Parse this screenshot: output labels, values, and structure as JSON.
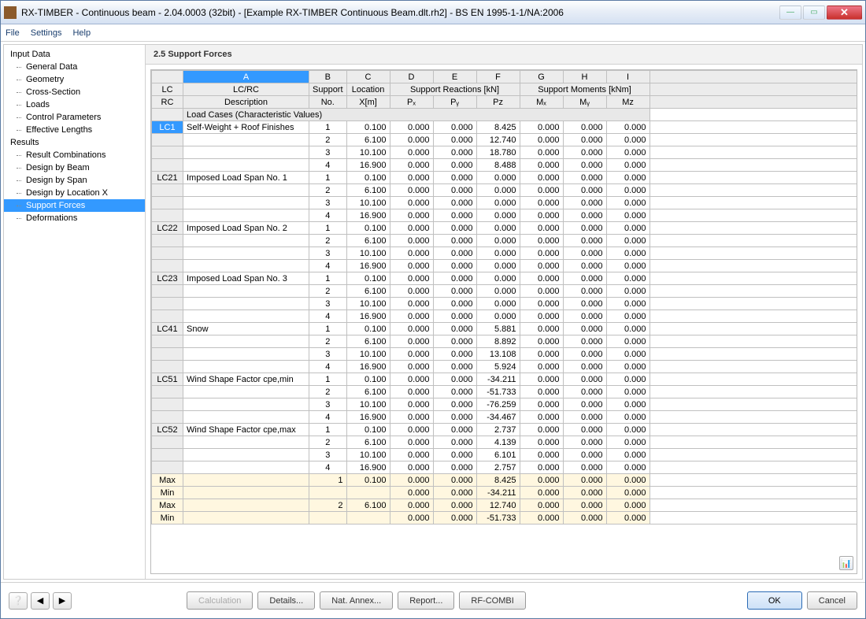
{
  "window": {
    "title": "RX-TIMBER - Continuous beam - 2.04.0003 (32bit) - [Example RX-TIMBER Continuous Beam.dlt.rh2] - BS EN 1995-1-1/NA:2006"
  },
  "menu": [
    "File",
    "Settings",
    "Help"
  ],
  "sidebar": {
    "groups": [
      {
        "label": "Input Data",
        "items": [
          "General Data",
          "Geometry",
          "Cross-Section",
          "Loads",
          "Control Parameters",
          "Effective Lengths"
        ]
      },
      {
        "label": "Results",
        "items": [
          "Result Combinations",
          "Design by Beam",
          "Design by Span",
          "Design by Location X",
          "Support Forces",
          "Deformations"
        ]
      }
    ],
    "selected": "Support Forces"
  },
  "section": {
    "title": "2.5 Support Forces"
  },
  "table": {
    "letters": [
      "A",
      "B",
      "C",
      "D",
      "E",
      "F",
      "G",
      "H",
      "I"
    ],
    "header1": {
      "lc": "LC",
      "desc": "LC/RC",
      "support": "Support",
      "location": "Location",
      "reactions": "Support Reactions [kN]",
      "moments": "Support Moments [kNm]"
    },
    "header2": {
      "rc": "RC",
      "desc": "Description",
      "no": "No.",
      "x": "X[m]",
      "px": "Pₓ",
      "py": "Pᵧ",
      "pz": "Pz",
      "mx": "Mₓ",
      "my": "Mᵧ",
      "mz": "Mz"
    },
    "group_label": "Load Cases (Characteristic Values)",
    "cases": [
      {
        "id": "LC1",
        "desc": "Self-Weight + Roof Finishes",
        "rows": [
          {
            "no": "1",
            "x": "0.100",
            "px": "0.000",
            "py": "0.000",
            "pz": "8.425",
            "mx": "0.000",
            "my": "0.000",
            "mz": "0.000"
          },
          {
            "no": "2",
            "x": "6.100",
            "px": "0.000",
            "py": "0.000",
            "pz": "12.740",
            "mx": "0.000",
            "my": "0.000",
            "mz": "0.000"
          },
          {
            "no": "3",
            "x": "10.100",
            "px": "0.000",
            "py": "0.000",
            "pz": "18.780",
            "mx": "0.000",
            "my": "0.000",
            "mz": "0.000"
          },
          {
            "no": "4",
            "x": "16.900",
            "px": "0.000",
            "py": "0.000",
            "pz": "8.488",
            "mx": "0.000",
            "my": "0.000",
            "mz": "0.000"
          }
        ]
      },
      {
        "id": "LC21",
        "desc": "Imposed Load Span No. 1",
        "rows": [
          {
            "no": "1",
            "x": "0.100",
            "px": "0.000",
            "py": "0.000",
            "pz": "0.000",
            "mx": "0.000",
            "my": "0.000",
            "mz": "0.000"
          },
          {
            "no": "2",
            "x": "6.100",
            "px": "0.000",
            "py": "0.000",
            "pz": "0.000",
            "mx": "0.000",
            "my": "0.000",
            "mz": "0.000"
          },
          {
            "no": "3",
            "x": "10.100",
            "px": "0.000",
            "py": "0.000",
            "pz": "0.000",
            "mx": "0.000",
            "my": "0.000",
            "mz": "0.000"
          },
          {
            "no": "4",
            "x": "16.900",
            "px": "0.000",
            "py": "0.000",
            "pz": "0.000",
            "mx": "0.000",
            "my": "0.000",
            "mz": "0.000"
          }
        ]
      },
      {
        "id": "LC22",
        "desc": "Imposed Load Span No. 2",
        "rows": [
          {
            "no": "1",
            "x": "0.100",
            "px": "0.000",
            "py": "0.000",
            "pz": "0.000",
            "mx": "0.000",
            "my": "0.000",
            "mz": "0.000"
          },
          {
            "no": "2",
            "x": "6.100",
            "px": "0.000",
            "py": "0.000",
            "pz": "0.000",
            "mx": "0.000",
            "my": "0.000",
            "mz": "0.000"
          },
          {
            "no": "3",
            "x": "10.100",
            "px": "0.000",
            "py": "0.000",
            "pz": "0.000",
            "mx": "0.000",
            "my": "0.000",
            "mz": "0.000"
          },
          {
            "no": "4",
            "x": "16.900",
            "px": "0.000",
            "py": "0.000",
            "pz": "0.000",
            "mx": "0.000",
            "my": "0.000",
            "mz": "0.000"
          }
        ]
      },
      {
        "id": "LC23",
        "desc": "Imposed Load Span No. 3",
        "rows": [
          {
            "no": "1",
            "x": "0.100",
            "px": "0.000",
            "py": "0.000",
            "pz": "0.000",
            "mx": "0.000",
            "my": "0.000",
            "mz": "0.000"
          },
          {
            "no": "2",
            "x": "6.100",
            "px": "0.000",
            "py": "0.000",
            "pz": "0.000",
            "mx": "0.000",
            "my": "0.000",
            "mz": "0.000"
          },
          {
            "no": "3",
            "x": "10.100",
            "px": "0.000",
            "py": "0.000",
            "pz": "0.000",
            "mx": "0.000",
            "my": "0.000",
            "mz": "0.000"
          },
          {
            "no": "4",
            "x": "16.900",
            "px": "0.000",
            "py": "0.000",
            "pz": "0.000",
            "mx": "0.000",
            "my": "0.000",
            "mz": "0.000"
          }
        ]
      },
      {
        "id": "LC41",
        "desc": "Snow",
        "rows": [
          {
            "no": "1",
            "x": "0.100",
            "px": "0.000",
            "py": "0.000",
            "pz": "5.881",
            "mx": "0.000",
            "my": "0.000",
            "mz": "0.000"
          },
          {
            "no": "2",
            "x": "6.100",
            "px": "0.000",
            "py": "0.000",
            "pz": "8.892",
            "mx": "0.000",
            "my": "0.000",
            "mz": "0.000"
          },
          {
            "no": "3",
            "x": "10.100",
            "px": "0.000",
            "py": "0.000",
            "pz": "13.108",
            "mx": "0.000",
            "my": "0.000",
            "mz": "0.000"
          },
          {
            "no": "4",
            "x": "16.900",
            "px": "0.000",
            "py": "0.000",
            "pz": "5.924",
            "mx": "0.000",
            "my": "0.000",
            "mz": "0.000"
          }
        ]
      },
      {
        "id": "LC51",
        "desc": "Wind Shape Factor cpe,min",
        "rows": [
          {
            "no": "1",
            "x": "0.100",
            "px": "0.000",
            "py": "0.000",
            "pz": "-34.211",
            "mx": "0.000",
            "my": "0.000",
            "mz": "0.000"
          },
          {
            "no": "2",
            "x": "6.100",
            "px": "0.000",
            "py": "0.000",
            "pz": "-51.733",
            "mx": "0.000",
            "my": "0.000",
            "mz": "0.000"
          },
          {
            "no": "3",
            "x": "10.100",
            "px": "0.000",
            "py": "0.000",
            "pz": "-76.259",
            "mx": "0.000",
            "my": "0.000",
            "mz": "0.000"
          },
          {
            "no": "4",
            "x": "16.900",
            "px": "0.000",
            "py": "0.000",
            "pz": "-34.467",
            "mx": "0.000",
            "my": "0.000",
            "mz": "0.000"
          }
        ]
      },
      {
        "id": "LC52",
        "desc": "Wind Shape Factor cpe,max",
        "rows": [
          {
            "no": "1",
            "x": "0.100",
            "px": "0.000",
            "py": "0.000",
            "pz": "2.737",
            "mx": "0.000",
            "my": "0.000",
            "mz": "0.000"
          },
          {
            "no": "2",
            "x": "6.100",
            "px": "0.000",
            "py": "0.000",
            "pz": "4.139",
            "mx": "0.000",
            "my": "0.000",
            "mz": "0.000"
          },
          {
            "no": "3",
            "x": "10.100",
            "px": "0.000",
            "py": "0.000",
            "pz": "6.101",
            "mx": "0.000",
            "my": "0.000",
            "mz": "0.000"
          },
          {
            "no": "4",
            "x": "16.900",
            "px": "0.000",
            "py": "0.000",
            "pz": "2.757",
            "mx": "0.000",
            "my": "0.000",
            "mz": "0.000"
          }
        ]
      }
    ],
    "summary": [
      {
        "label": "Max",
        "no": "1",
        "x": "0.100",
        "px": "0.000",
        "py": "0.000",
        "pz": "8.425",
        "mx": "0.000",
        "my": "0.000",
        "mz": "0.000"
      },
      {
        "label": "Min",
        "no": "",
        "x": "",
        "px": "0.000",
        "py": "0.000",
        "pz": "-34.211",
        "mx": "0.000",
        "my": "0.000",
        "mz": "0.000"
      },
      {
        "label": "Max",
        "no": "2",
        "x": "6.100",
        "px": "0.000",
        "py": "0.000",
        "pz": "12.740",
        "mx": "0.000",
        "my": "0.000",
        "mz": "0.000"
      },
      {
        "label": "Min",
        "no": "",
        "x": "",
        "px": "0.000",
        "py": "0.000",
        "pz": "-51.733",
        "mx": "0.000",
        "my": "0.000",
        "mz": "0.000"
      }
    ]
  },
  "footer": {
    "calculation": "Calculation",
    "details": "Details...",
    "annex": "Nat. Annex...",
    "report": "Report...",
    "rfcombi": "RF-COMBI",
    "ok": "OK",
    "cancel": "Cancel"
  }
}
